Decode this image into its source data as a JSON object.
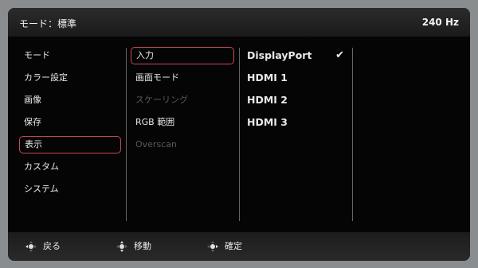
{
  "header": {
    "mode_label": "モード：標準",
    "refresh_rate": "240 Hz"
  },
  "menu": {
    "items": [
      {
        "label": "モード"
      },
      {
        "label": "カラー設定"
      },
      {
        "label": "画像"
      },
      {
        "label": "保存"
      },
      {
        "label": "表示",
        "selected": true
      },
      {
        "label": "カスタム"
      },
      {
        "label": "システム"
      }
    ]
  },
  "submenu": {
    "items": [
      {
        "label": "入力",
        "selected": true
      },
      {
        "label": "画面モード"
      },
      {
        "label": "スケーリング",
        "disabled": true
      },
      {
        "label": "RGB 範囲"
      },
      {
        "label": "Overscan",
        "disabled": true
      }
    ]
  },
  "options": {
    "items": [
      {
        "label": "DisplayPort",
        "checked": true
      },
      {
        "label": "HDMI 1"
      },
      {
        "label": "HDMI 2"
      },
      {
        "label": "HDMI 3"
      }
    ],
    "check_icon": "checkmark-icon"
  },
  "footer": {
    "back_label": "戻る",
    "move_label": "移動",
    "confirm_label": "確定",
    "icon": "joystick-icon"
  }
}
